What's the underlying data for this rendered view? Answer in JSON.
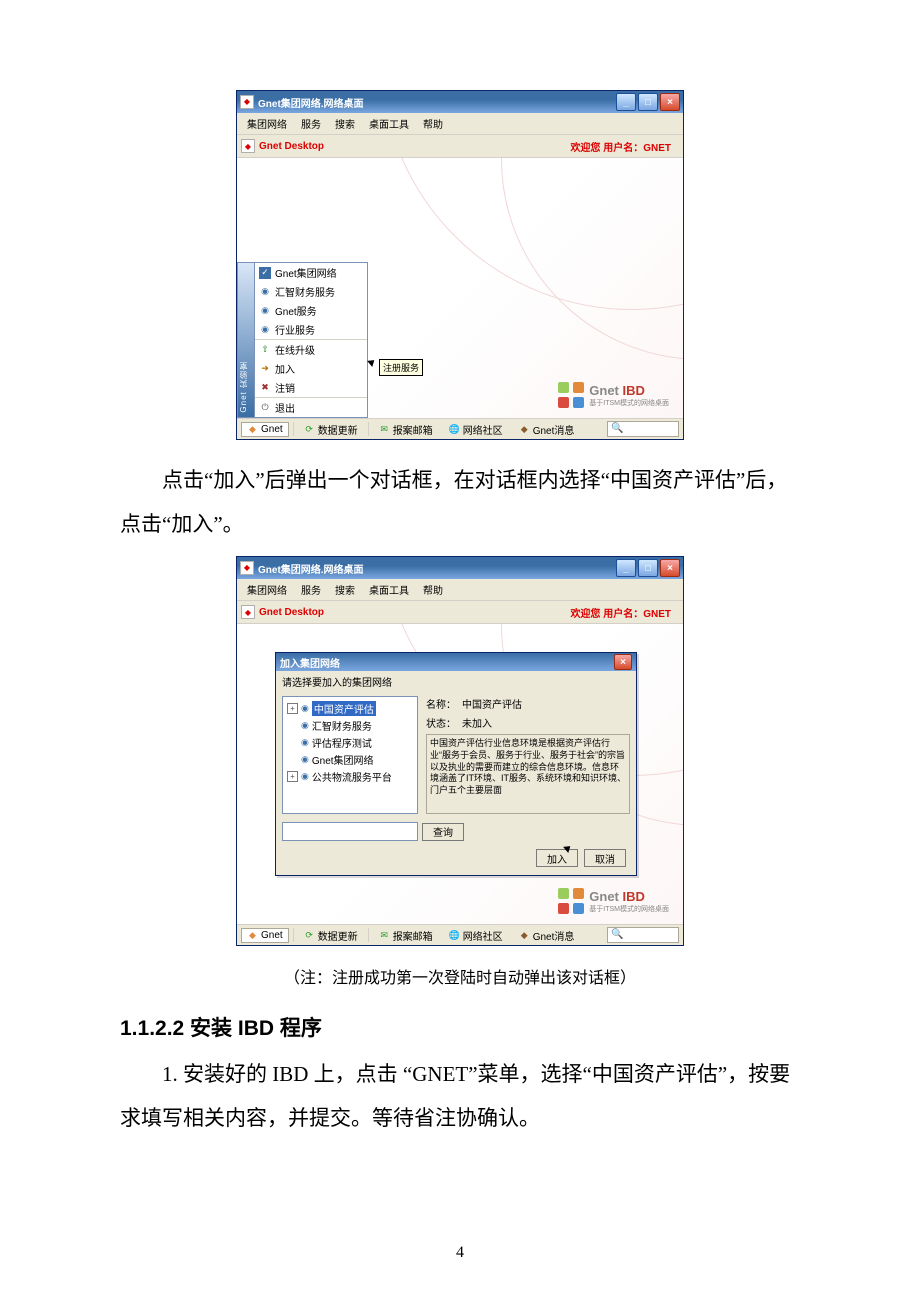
{
  "page_number": "4",
  "body": {
    "p1": "点击“加入”后弹出一个对话框，在对话框内选择“中国资产评估”后，点击“加入”。",
    "caption": "（注：注册成功第一次登陆时自动弹出该对话框）",
    "heading_full": "1.1.2.2 安装 IBD 程序",
    "p2": "1. 安装好的 IBD 上，点击 “GNET”菜单，选择“中国资产评估”，按要求填写相关内容，并提交。等待省注协确认。"
  },
  "common": {
    "app_title": "Gnet集团网络.网络桌面",
    "menubar": [
      "集团网络",
      "服务",
      "搜索",
      "桌面工具",
      "帮助"
    ],
    "toolbar_title": "Gnet Desktop",
    "welcome": "欢迎您 用户名：GNET",
    "ibd_logo_main_g": "Gnet",
    "ibd_logo_main_ibd": " IBD",
    "ibd_logo_sub": "基于ITSM模式的网络桌面",
    "statusbar": {
      "gnet": "Gnet",
      "refresh": "数据更新",
      "mailbox": "报案邮箱",
      "community": "网络社区",
      "msg": "Gnet消息"
    }
  },
  "shot1": {
    "side_label": "Gnet 实验室",
    "items": [
      "Gnet集团网络",
      "汇智财务服务",
      "Gnet服务",
      "行业服务",
      "在线升级",
      "加入",
      "注销",
      "退出"
    ],
    "tooltip": "注册服务"
  },
  "shot2": {
    "dlg_title": "加入集团网络",
    "dlg_sub": "请选择要加入的集团网络",
    "tree": [
      "中国资产评估",
      "汇智财务服务",
      "评估程序测试",
      "Gnet集团网络",
      "公共物流服务平台"
    ],
    "name_label": "名称：",
    "name_value": "中国资产评估",
    "state_label": "状态：",
    "state_value": "未加入",
    "desc": "中国资产评估行业信息环境是根据资产评估行业“服务于会员、服务于行业、服务于社会”的宗旨以及执业的需要而建立的综合信息环境。信息环境涵盖了IT环境、IT服务、系统环境和知识环境、门户五个主要层面",
    "search_btn": "查询",
    "join_btn": "加入",
    "cancel_btn": "取消"
  }
}
